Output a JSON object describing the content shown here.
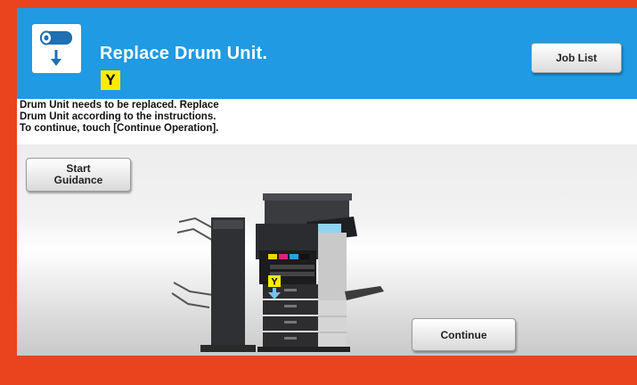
{
  "header": {
    "title": "Replace Drum Unit.",
    "color_badge": "Y",
    "job_list_label": "Job List",
    "icon": "drum-unit-icon"
  },
  "message": {
    "lines": [
      "Drum Unit needs to be replaced. Replace",
      "Drum Unit according to the instructions.",
      "To continue, touch [Continue Operation]."
    ]
  },
  "guidance": {
    "start_label_line1": "Start",
    "start_label_line2": "Guidance"
  },
  "illustration": {
    "icon": "printer-illustration",
    "marker_label": "Y"
  },
  "footer": {
    "continue_label": "Continue"
  },
  "colors": {
    "frame": "#e8451e",
    "header": "#1f9ae3",
    "badge": "#ffec00"
  }
}
